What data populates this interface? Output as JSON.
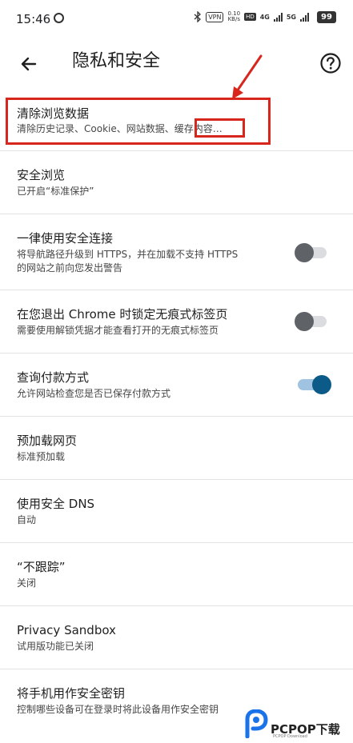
{
  "status_bar": {
    "time": "15:46",
    "vpn": "VPN",
    "speed": "0.10\nKB/s",
    "hd": "HD",
    "network_1": "4G",
    "network_2": "5G",
    "battery": "99"
  },
  "toolbar": {
    "title": "隐私和安全"
  },
  "settings": [
    {
      "title": "清除浏览数据",
      "subtitle": "清除历史记录、Cookie、网站数据、缓存内容…"
    },
    {
      "title": "安全浏览",
      "subtitle": "已开启“标准保护”"
    },
    {
      "title": "一律使用安全连接",
      "subtitle_line1": "将导航路径升级到 HTTPS，并在加载不支持 HTTPS",
      "subtitle_line2": "的网站之前向您发出警告",
      "toggle_on": false
    },
    {
      "title": "在您退出 Chrome 时锁定无痕式标签页",
      "subtitle": "需要使用解锁凭据才能查看打开的无痕式标签页",
      "toggle_on": false
    },
    {
      "title": "查询付款方式",
      "subtitle": "允许网站检查您是否已保存付款方式",
      "toggle_on": true
    },
    {
      "title": "预加载网页",
      "subtitle": "标准预加载"
    },
    {
      "title": "使用安全 DNS",
      "subtitle": "自动"
    },
    {
      "title": "“不跟踪”",
      "subtitle": "关闭"
    },
    {
      "title": "Privacy Sandbox",
      "subtitle": "试用版功能已关闭"
    },
    {
      "title": "将手机用作安全密钥",
      "subtitle": "控制哪些设备可在登录时将此设备用作安全密钥"
    }
  ],
  "colors": {
    "annotation": "#d9261c",
    "toggle_on_thumb": "#0b5a87",
    "toggle_off_thumb": "#5f6368"
  },
  "watermark": {
    "text": "PCPOP下载",
    "sub": "PCPOP Download"
  }
}
